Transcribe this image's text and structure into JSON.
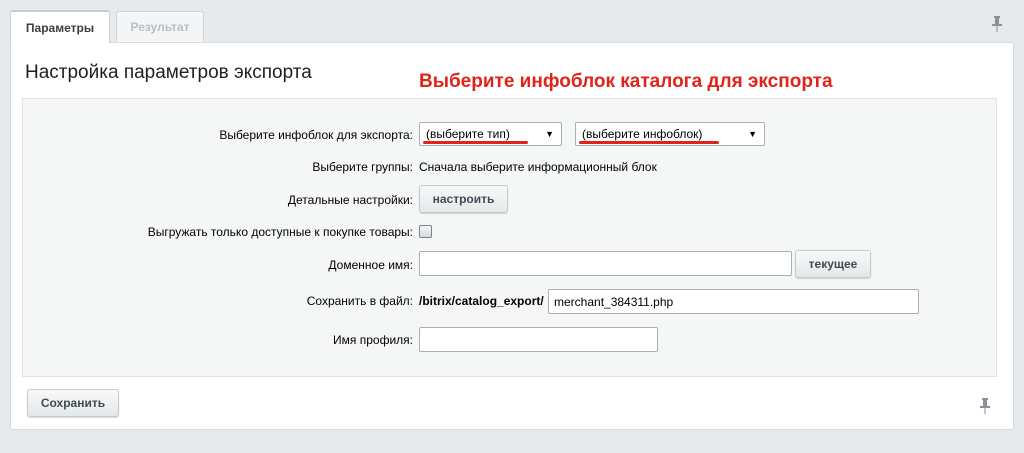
{
  "tabs": [
    {
      "label": "Параметры",
      "active": true
    },
    {
      "label": "Результат",
      "active": false
    }
  ],
  "page_title": "Настройка параметров экспорта",
  "annotation": "Выберите инфоблок каталога для экспорта",
  "form": {
    "iblock_label": "Выберите инфоблок для экспорта:",
    "type_select": "(выберите тип)",
    "iblock_select": "(выберите инфоблок)",
    "groups_label": "Выберите группы:",
    "groups_value": "Сначала выберите информационный блок",
    "detail_label": "Детальные настройки:",
    "detail_button": "настроить",
    "available_label": "Выгружать только доступные к покупке товары:",
    "available_checked": false,
    "domain_label": "Доменное имя:",
    "domain_value": "",
    "domain_button": "текущее",
    "file_label": "Сохранить в файл:",
    "file_prefix": "/bitrix/catalog_export/",
    "file_value": "merchant_384311.php",
    "profile_label": "Имя профиля:",
    "profile_value": ""
  },
  "footer": {
    "save_button": "Сохранить"
  },
  "icons": {
    "pin": "pin-icon",
    "dropdown": "dropdown-arrow-icon"
  },
  "colors": {
    "annotation": "#e2231a",
    "background": "#e7eaec"
  }
}
